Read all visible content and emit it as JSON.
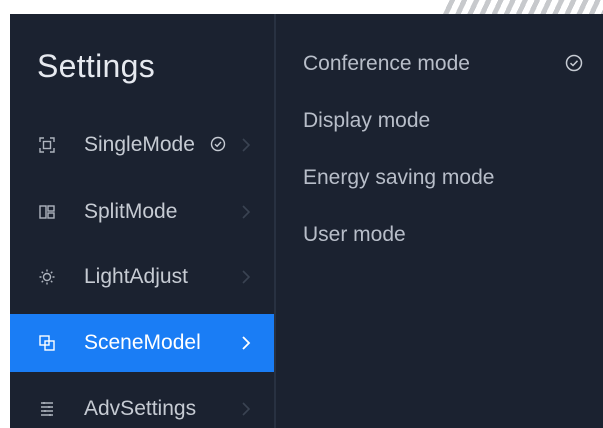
{
  "sidebar": {
    "title": "Settings",
    "items": [
      {
        "label": "SingleMode",
        "icon": "single-screen-icon",
        "checked": true,
        "active": false
      },
      {
        "label": "SplitMode",
        "icon": "split-screen-icon",
        "checked": false,
        "active": false
      },
      {
        "label": "LightAdjust",
        "icon": "brightness-icon",
        "checked": false,
        "active": false
      },
      {
        "label": "SceneModel",
        "icon": "scene-layers-icon",
        "checked": false,
        "active": true
      },
      {
        "label": "AdvSettings",
        "icon": "advanced-settings-icon",
        "checked": false,
        "active": false
      }
    ]
  },
  "scene_options": {
    "items": [
      {
        "label": "Conference mode",
        "selected": true
      },
      {
        "label": "Display mode",
        "selected": false
      },
      {
        "label": "Energy saving mode",
        "selected": false
      },
      {
        "label": "User mode",
        "selected": false
      }
    ]
  },
  "colors": {
    "background": "#1b2230",
    "active_item": "#1a7df5",
    "text_primary": "#e6e9ef",
    "text_secondary": "#b8bec9"
  }
}
